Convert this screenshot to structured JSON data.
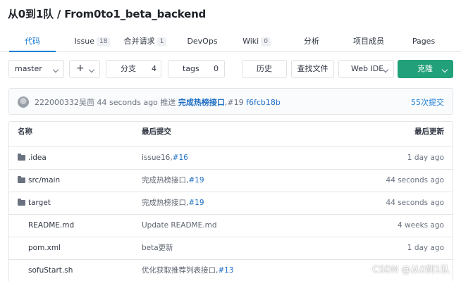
{
  "repo": {
    "title": "从0到1队 / From0to1_beta_backend"
  },
  "tabs": [
    {
      "label": "代码",
      "count": ""
    },
    {
      "label": "Issue",
      "count": "18"
    },
    {
      "label": "合并请求",
      "count": "1"
    },
    {
      "label": "DevOps",
      "count": ""
    },
    {
      "label": "Wiki",
      "count": "0"
    },
    {
      "label": "分析",
      "count": ""
    },
    {
      "label": "项目成员",
      "count": ""
    },
    {
      "label": "Pages",
      "count": ""
    }
  ],
  "toolbar": {
    "branch": "master",
    "add": "+",
    "branches_label": "分支",
    "branches_count": "4",
    "tags_label": "tags",
    "tags_count": "0",
    "history": "历史",
    "find_file": "查找文件",
    "web_ide": "Web IDE",
    "clone": "克隆"
  },
  "commit": {
    "author": "222000332吴茴",
    "time": "44 seconds ago",
    "verb": "推送",
    "message": "完成热榜接口",
    "ref": ",#19",
    "hash": "f6fcb18b",
    "count": "55次提交"
  },
  "table": {
    "headers": {
      "name": "名称",
      "commit": "最后提交",
      "time": "最后更新"
    },
    "rows": [
      {
        "type": "folder",
        "name": ".idea",
        "commit": "issue16,",
        "ref": "#16",
        "time": "1 day ago"
      },
      {
        "type": "folder",
        "name": "src/main",
        "commit": "完成热榜接口,",
        "ref": "#19",
        "time": "44 seconds ago"
      },
      {
        "type": "folder",
        "name": "target",
        "commit": "完成热榜接口,",
        "ref": "#19",
        "time": "44 seconds ago"
      },
      {
        "type": "file",
        "name": "README.md",
        "commit": "Update README.md",
        "ref": "",
        "time": "4 weeks ago"
      },
      {
        "type": "file",
        "name": "pom.xml",
        "commit": "beta更新",
        "ref": "",
        "time": "1 day ago"
      },
      {
        "type": "file",
        "name": "sofuStart.sh",
        "commit": "优化获取推荐列表接口,",
        "ref": "#13",
        "time": ""
      }
    ]
  },
  "watermark": "CSDN @从0到1队"
}
